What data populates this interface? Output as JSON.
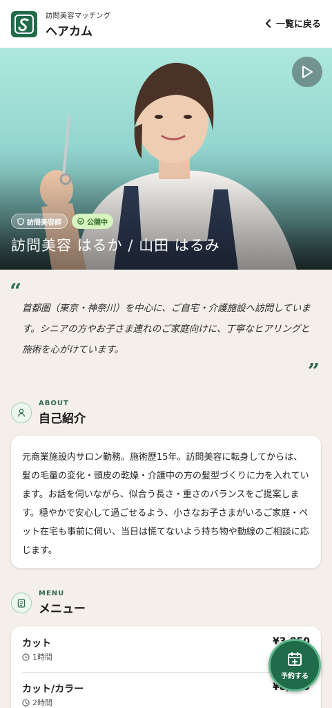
{
  "header": {
    "subtitle": "訪問美容マッチング",
    "title": "ヘアカム",
    "back_label": "一覧に戻る"
  },
  "hero": {
    "badges": [
      {
        "label": "訪問美容師",
        "icon": "shield-icon"
      },
      {
        "label": "公開中",
        "icon": "check-circle-icon"
      }
    ],
    "name": "訪問美容 はるか / 山田 はるみ"
  },
  "quote": {
    "open_mark": "“",
    "text": "首都圏（東京・神奈川）を中心に、ご自宅・介護施設へ訪問しています。シニアの方やお子さま連れのご家庭向けに、丁寧なヒアリングと施術を心がけています。",
    "close_mark": "”"
  },
  "about": {
    "label_en": "ABOUT",
    "label_jp": "自己紹介",
    "body": "元商業施設内サロン勤務。施術歴15年。訪問美容に転身してからは、髪の毛量の変化・頭皮の乾燥・介護中の方の髪型づくりに力を入れています。お話を伺いながら、似合う長さ・重さのバランスをご提案します。穏やかで安心して過ごせるよう、小さなお子さまがいるご家庭・ペット在宅も事前に伺い、当日は慌てないよう持ち物や動線のご相談に応じます。"
  },
  "menu": {
    "label_en": "MENU",
    "label_jp": "メニュー",
    "items": [
      {
        "name": "カット",
        "duration": "1時間",
        "price": "¥3,850"
      },
      {
        "name": "カット/カラー",
        "duration": "2時間",
        "price": "¥8,250"
      }
    ]
  },
  "reserve": {
    "label": "予約する"
  },
  "colors": {
    "brand": "#1f6b4a",
    "accent": "#2e6b4e",
    "background": "#f4efe9",
    "status_badge": "#d7f5bf"
  }
}
